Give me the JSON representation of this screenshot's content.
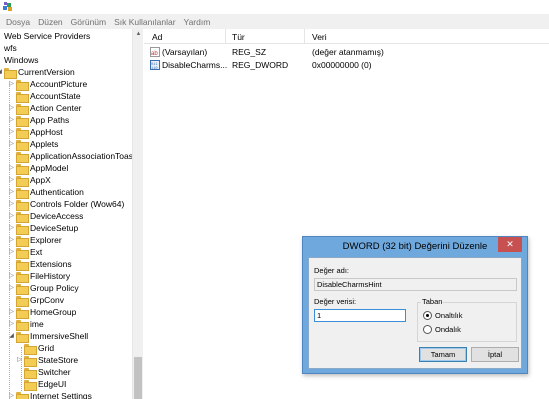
{
  "menu": [
    "Dosya",
    "Düzen",
    "Görünüm",
    "Sık Kullanılanlar",
    "Yardım"
  ],
  "tree": {
    "items": [
      {
        "label": "Web Service Providers",
        "level": 0,
        "folder": false,
        "expander": ""
      },
      {
        "label": "wfs",
        "level": 0,
        "folder": false,
        "expander": ""
      },
      {
        "label": "Windows",
        "level": 0,
        "folder": false,
        "expander": ""
      },
      {
        "label": "CurrentVersion",
        "level": 1,
        "folder": true,
        "expander": "◢"
      },
      {
        "label": "AccountPicture",
        "level": 2,
        "folder": true,
        "expander": "▷"
      },
      {
        "label": "AccountState",
        "level": 2,
        "folder": true,
        "expander": ""
      },
      {
        "label": "Action Center",
        "level": 2,
        "folder": true,
        "expander": "▷"
      },
      {
        "label": "App Paths",
        "level": 2,
        "folder": true,
        "expander": "▷"
      },
      {
        "label": "AppHost",
        "level": 2,
        "folder": true,
        "expander": "▷"
      },
      {
        "label": "Applets",
        "level": 2,
        "folder": true,
        "expander": "▷"
      },
      {
        "label": "ApplicationAssociationToasts",
        "level": 2,
        "folder": true,
        "expander": ""
      },
      {
        "label": "AppModel",
        "level": 2,
        "folder": true,
        "expander": "▷"
      },
      {
        "label": "AppX",
        "level": 2,
        "folder": true,
        "expander": "▷"
      },
      {
        "label": "Authentication",
        "level": 2,
        "folder": true,
        "expander": "▷"
      },
      {
        "label": "Controls Folder (Wow64)",
        "level": 2,
        "folder": true,
        "expander": "▷"
      },
      {
        "label": "DeviceAccess",
        "level": 2,
        "folder": true,
        "expander": "▷"
      },
      {
        "label": "DeviceSetup",
        "level": 2,
        "folder": true,
        "expander": "▷"
      },
      {
        "label": "Explorer",
        "level": 2,
        "folder": true,
        "expander": "▷"
      },
      {
        "label": "Ext",
        "level": 2,
        "folder": true,
        "expander": "▷"
      },
      {
        "label": "Extensions",
        "level": 2,
        "folder": true,
        "expander": ""
      },
      {
        "label": "FileHistory",
        "level": 2,
        "folder": true,
        "expander": "▷"
      },
      {
        "label": "Group Policy",
        "level": 2,
        "folder": true,
        "expander": "▷"
      },
      {
        "label": "GrpConv",
        "level": 2,
        "folder": true,
        "expander": ""
      },
      {
        "label": "HomeGroup",
        "level": 2,
        "folder": true,
        "expander": "▷"
      },
      {
        "label": "ime",
        "level": 2,
        "folder": true,
        "expander": "▷"
      },
      {
        "label": "ImmersiveShell",
        "level": 2,
        "folder": true,
        "expander": "◢"
      },
      {
        "label": "Grid",
        "level": 3,
        "folder": true,
        "expander": ""
      },
      {
        "label": "StateStore",
        "level": 3,
        "folder": true,
        "expander": "▷"
      },
      {
        "label": "Switcher",
        "level": 3,
        "folder": true,
        "expander": ""
      },
      {
        "label": "EdgeUI",
        "level": 3,
        "folder": true,
        "expander": ""
      },
      {
        "label": "Internet Settings",
        "level": 2,
        "folder": true,
        "expander": "▷"
      }
    ]
  },
  "list": {
    "headers": {
      "name": "Ad",
      "type": "Tür",
      "data": "Veri"
    },
    "rows": [
      {
        "name": "(Varsayılan)",
        "type": "REG_SZ",
        "data": "(değer atanmamış)",
        "icon": "string-value-icon"
      },
      {
        "name": "DisableCharms...",
        "type": "REG_DWORD",
        "data": "0x00000000 (0)",
        "icon": "binary-value-icon"
      }
    ]
  },
  "dialog": {
    "title": "DWORD (32 bit) Değerini Düzenle",
    "close": "✕",
    "value_name_label": "Değer adı:",
    "value_name": "DisableCharmsHint",
    "value_data_label": "Değer verisi:",
    "value_data": "1",
    "base_label": "Taban",
    "base_options": [
      {
        "label": "Onaltılık",
        "checked": true
      },
      {
        "label": "Ondalık",
        "checked": false
      }
    ],
    "ok_label": "Tamam",
    "cancel_label": "İptal"
  },
  "colors": {
    "dialog_frame": "#6fa8dc",
    "close_button": "#c75050",
    "folder": "#f2cc55"
  }
}
